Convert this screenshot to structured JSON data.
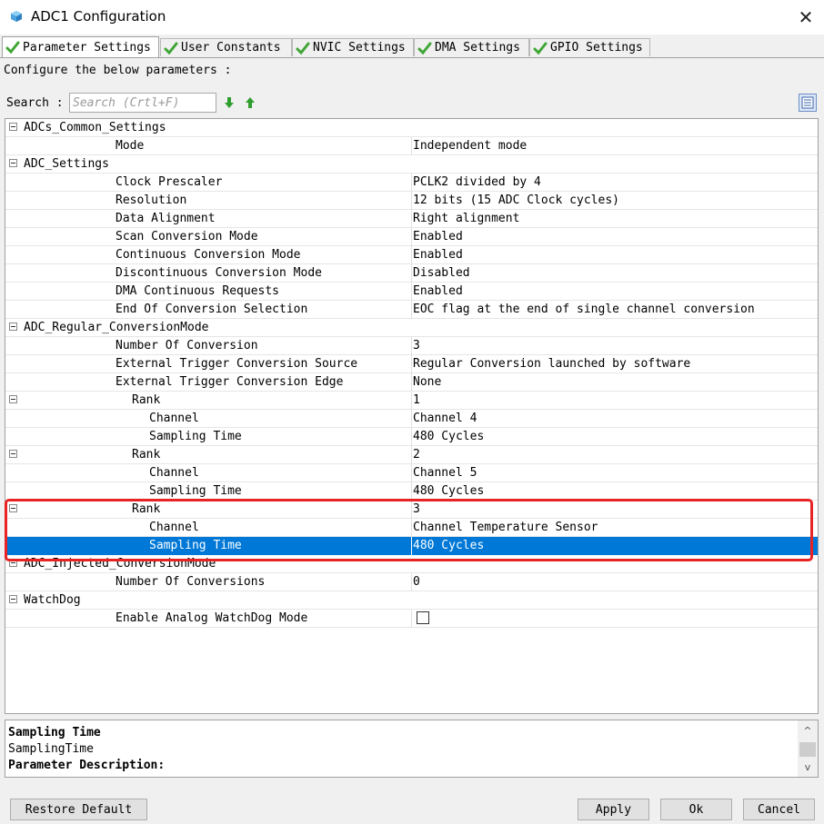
{
  "window": {
    "title": "ADC1 Configuration",
    "close_glyph": "✕"
  },
  "tabs": [
    {
      "label": "Parameter Settings",
      "active": true,
      "icon": "check-icon"
    },
    {
      "label": "User Constants",
      "active": false,
      "icon": "check-icon"
    },
    {
      "label": "NVIC Settings",
      "active": false,
      "icon": "check-icon"
    },
    {
      "label": "DMA Settings",
      "active": false,
      "icon": "check-icon"
    },
    {
      "label": "GPIO Settings",
      "active": false,
      "icon": "check-icon"
    }
  ],
  "configure_text": "Configure the below parameters :",
  "search": {
    "label": "Search :",
    "placeholder": "Search (Crtl+F)"
  },
  "tree": [
    {
      "name": "ADCs_Common_Settings",
      "value": "",
      "group": true,
      "level": 0
    },
    {
      "name": "Mode",
      "value": "Independent mode",
      "level": 1
    },
    {
      "name": "ADC_Settings",
      "value": "",
      "group": true,
      "level": 0
    },
    {
      "name": "Clock Prescaler",
      "value": "PCLK2 divided by 4",
      "level": 1
    },
    {
      "name": "Resolution",
      "value": "12 bits (15 ADC Clock cycles)",
      "level": 1
    },
    {
      "name": "Data Alignment",
      "value": "Right alignment",
      "level": 1
    },
    {
      "name": "Scan Conversion Mode",
      "value": "Enabled",
      "level": 1
    },
    {
      "name": "Continuous Conversion Mode",
      "value": "Enabled",
      "level": 1
    },
    {
      "name": "Discontinuous Conversion Mode",
      "value": "Disabled",
      "level": 1
    },
    {
      "name": "DMA Continuous Requests",
      "value": "Enabled",
      "level": 1
    },
    {
      "name": "End Of Conversion Selection",
      "value": "EOC flag at the end of single channel conversion",
      "level": 1
    },
    {
      "name": "ADC_Regular_ConversionMode",
      "value": "",
      "group": true,
      "level": 0
    },
    {
      "name": "Number Of Conversion",
      "value": "3",
      "level": 1
    },
    {
      "name": "External Trigger Conversion Source",
      "value": "Regular Conversion launched by software",
      "level": 1
    },
    {
      "name": "External Trigger Conversion Edge",
      "value": "None",
      "level": 1
    },
    {
      "name": "Rank",
      "value": "1",
      "level": 2,
      "expandable": true
    },
    {
      "name": "Channel",
      "value": "Channel 4",
      "level": 3
    },
    {
      "name": "Sampling Time",
      "value": "480 Cycles",
      "level": 3
    },
    {
      "name": "Rank",
      "value": "2",
      "level": 2,
      "expandable": true
    },
    {
      "name": "Channel",
      "value": "Channel 5",
      "level": 3
    },
    {
      "name": "Sampling Time",
      "value": "480 Cycles",
      "level": 3
    },
    {
      "name": "Rank",
      "value": "3",
      "level": 2,
      "expandable": true
    },
    {
      "name": "Channel",
      "value": "Channel Temperature Sensor",
      "level": 3
    },
    {
      "name": "Sampling Time",
      "value": "480 Cycles",
      "level": 3,
      "selected": true
    },
    {
      "name": "ADC_Injected_ConversionMode",
      "value": "",
      "group": true,
      "level": 0
    },
    {
      "name": "Number Of Conversions",
      "value": "0",
      "level": 1
    },
    {
      "name": "WatchDog",
      "value": "",
      "group": true,
      "level": 0
    },
    {
      "name": "Enable Analog WatchDog Mode",
      "value": "",
      "level": 1,
      "checkbox": true,
      "checked": false
    }
  ],
  "description": {
    "title": "Sampling Time",
    "param_name": "SamplingTime",
    "section_label": "Parameter Description:"
  },
  "buttons": {
    "restore_default": "Restore Default",
    "apply": "Apply",
    "ok": "Ok",
    "cancel": "Cancel"
  },
  "colors": {
    "selection": "#0078d7",
    "highlight_box": "#e82323",
    "check": "#3fa535",
    "arrow": "#2f9e2f"
  }
}
